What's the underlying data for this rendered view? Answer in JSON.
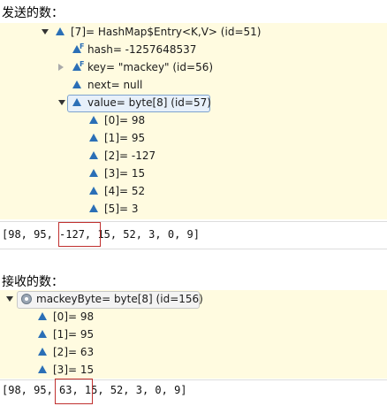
{
  "send": {
    "heading": "发送的数：",
    "rows": {
      "entry": "[7]= HashMap$Entry<K,V>  (id=51)",
      "hash": "hash= -1257648537",
      "key": "key= \"mackey\" (id=56)",
      "next": "next= null",
      "value": "value= byte[8]  (id=57)"
    },
    "elements": [
      "[0]= 98",
      "[1]= 95",
      "[2]= -127",
      "[3]= 15",
      "[4]= 52",
      "[5]= 3"
    ],
    "output": "[98, 95, -127, 15, 52, 3, 0, 9]"
  },
  "receive": {
    "heading": "接收的数：",
    "variable": "mackeyByte= byte[8]  (id=156)",
    "elements": [
      "[0]= 98",
      "[1]= 95",
      "[2]= 63",
      "[3]= 15"
    ],
    "output": "[98, 95, 63, 15, 52, 3, 0, 9]"
  },
  "colors": {
    "panel_bg": "#fffbe0",
    "highlight_box": "#c0302f",
    "field_icon": "#2b6fb6",
    "selection_bg": "#e7f0fa"
  }
}
